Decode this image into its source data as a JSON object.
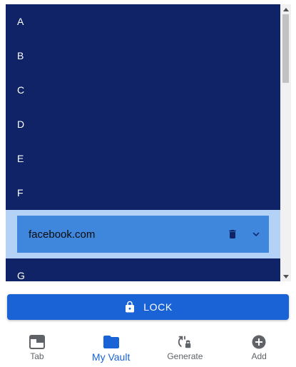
{
  "vault_list": {
    "letters_before": [
      "A",
      "B",
      "C",
      "D",
      "E",
      "F"
    ],
    "item": {
      "name": "facebook.com",
      "delete_icon": "trash-icon",
      "expand_icon": "chevron-down-icon"
    },
    "letters_after": [
      "G"
    ]
  },
  "lock_button": {
    "label": "LOCK",
    "icon": "lock-icon"
  },
  "bottom_nav": {
    "items": [
      {
        "label": "Tab",
        "icon": "tab-icon",
        "active": false
      },
      {
        "label": "My Vault",
        "icon": "folder-icon",
        "active": true
      },
      {
        "label": "Generate",
        "icon": "generate-icon",
        "active": false
      },
      {
        "label": "Add",
        "icon": "add-icon",
        "active": false
      }
    ]
  },
  "colors": {
    "list_background": "#0f2366",
    "item_highlight": "#b3d2f5",
    "item_card": "#3f86dd",
    "accent": "#1a63d6",
    "nav_inactive": "#5f6368"
  }
}
